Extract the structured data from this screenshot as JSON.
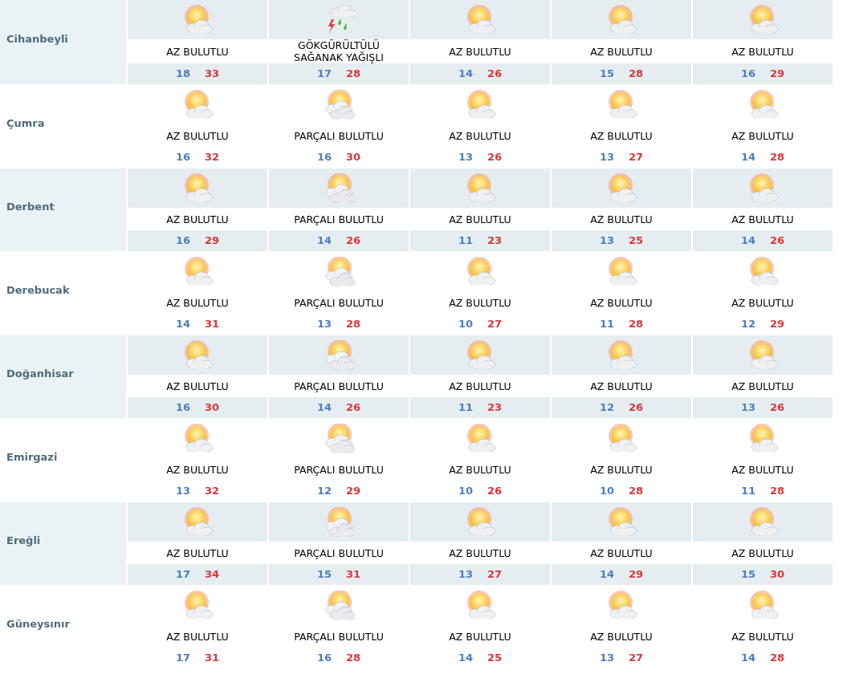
{
  "cities": [
    {
      "name": "Cihanbeyli",
      "days": [
        {
          "kind": "few_clouds",
          "condition": "AZ BULUTLU",
          "low": "18",
          "high": "33"
        },
        {
          "kind": "thunderstorm",
          "condition": "GÖKGÜRÜLTÜLÜ SAĞANAK YAĞIŞLI",
          "low": "17",
          "high": "28"
        },
        {
          "kind": "few_clouds",
          "condition": "AZ BULUTLU",
          "low": "14",
          "high": "26"
        },
        {
          "kind": "few_clouds",
          "condition": "AZ BULUTLU",
          "low": "15",
          "high": "28"
        },
        {
          "kind": "few_clouds",
          "condition": "AZ BULUTLU",
          "low": "16",
          "high": "29"
        }
      ]
    },
    {
      "name": "Çumra",
      "days": [
        {
          "kind": "few_clouds",
          "condition": "AZ BULUTLU",
          "low": "16",
          "high": "32"
        },
        {
          "kind": "partly_cloudy",
          "condition": "PARÇALI BULUTLU",
          "low": "16",
          "high": "30"
        },
        {
          "kind": "few_clouds",
          "condition": "AZ BULUTLU",
          "low": "13",
          "high": "26"
        },
        {
          "kind": "few_clouds",
          "condition": "AZ BULUTLU",
          "low": "13",
          "high": "27"
        },
        {
          "kind": "few_clouds",
          "condition": "AZ BULUTLU",
          "low": "14",
          "high": "28"
        }
      ]
    },
    {
      "name": "Derbent",
      "days": [
        {
          "kind": "few_clouds",
          "condition": "AZ BULUTLU",
          "low": "16",
          "high": "29"
        },
        {
          "kind": "partly_cloudy",
          "condition": "PARÇALI BULUTLU",
          "low": "14",
          "high": "26"
        },
        {
          "kind": "few_clouds",
          "condition": "AZ BULUTLU",
          "low": "11",
          "high": "23"
        },
        {
          "kind": "few_clouds",
          "condition": "AZ BULUTLU",
          "low": "13",
          "high": "25"
        },
        {
          "kind": "few_clouds",
          "condition": "AZ BULUTLU",
          "low": "14",
          "high": "26"
        }
      ]
    },
    {
      "name": "Derebucak",
      "days": [
        {
          "kind": "few_clouds",
          "condition": "AZ BULUTLU",
          "low": "14",
          "high": "31"
        },
        {
          "kind": "partly_cloudy",
          "condition": "PARÇALI BULUTLU",
          "low": "13",
          "high": "28"
        },
        {
          "kind": "few_clouds",
          "condition": "AZ BULUTLU",
          "low": "10",
          "high": "27"
        },
        {
          "kind": "few_clouds",
          "condition": "AZ BULUTLU",
          "low": "11",
          "high": "28"
        },
        {
          "kind": "few_clouds",
          "condition": "AZ BULUTLU",
          "low": "12",
          "high": "29"
        }
      ]
    },
    {
      "name": "Doğanhisar",
      "days": [
        {
          "kind": "few_clouds",
          "condition": "AZ BULUTLU",
          "low": "16",
          "high": "30"
        },
        {
          "kind": "partly_cloudy",
          "condition": "PARÇALI BULUTLU",
          "low": "14",
          "high": "26"
        },
        {
          "kind": "few_clouds",
          "condition": "AZ BULUTLU",
          "low": "11",
          "high": "23"
        },
        {
          "kind": "few_clouds",
          "condition": "AZ BULUTLU",
          "low": "12",
          "high": "26"
        },
        {
          "kind": "few_clouds",
          "condition": "AZ BULUTLU",
          "low": "13",
          "high": "26"
        }
      ]
    },
    {
      "name": "Emirgazi",
      "days": [
        {
          "kind": "few_clouds",
          "condition": "AZ BULUTLU",
          "low": "13",
          "high": "32"
        },
        {
          "kind": "partly_cloudy",
          "condition": "PARÇALI BULUTLU",
          "low": "12",
          "high": "29"
        },
        {
          "kind": "few_clouds",
          "condition": "AZ BULUTLU",
          "low": "10",
          "high": "26"
        },
        {
          "kind": "few_clouds",
          "condition": "AZ BULUTLU",
          "low": "10",
          "high": "28"
        },
        {
          "kind": "few_clouds",
          "condition": "AZ BULUTLU",
          "low": "11",
          "high": "28"
        }
      ]
    },
    {
      "name": "Ereğli",
      "days": [
        {
          "kind": "few_clouds",
          "condition": "AZ BULUTLU",
          "low": "17",
          "high": "34"
        },
        {
          "kind": "partly_cloudy",
          "condition": "PARÇALI BULUTLU",
          "low": "15",
          "high": "31"
        },
        {
          "kind": "few_clouds",
          "condition": "AZ BULUTLU",
          "low": "13",
          "high": "27"
        },
        {
          "kind": "few_clouds",
          "condition": "AZ BULUTLU",
          "low": "14",
          "high": "29"
        },
        {
          "kind": "few_clouds",
          "condition": "AZ BULUTLU",
          "low": "15",
          "high": "30"
        }
      ]
    },
    {
      "name": "Güneysınır",
      "days": [
        {
          "kind": "few_clouds",
          "condition": "AZ BULUTLU",
          "low": "17",
          "high": "31"
        },
        {
          "kind": "partly_cloudy",
          "condition": "PARÇALI BULUTLU",
          "low": "16",
          "high": "28"
        },
        {
          "kind": "few_clouds",
          "condition": "AZ BULUTLU",
          "low": "14",
          "high": "25"
        },
        {
          "kind": "few_clouds",
          "condition": "AZ BULUTLU",
          "low": "13",
          "high": "27"
        },
        {
          "kind": "few_clouds",
          "condition": "AZ BULUTLU",
          "low": "14",
          "high": "28"
        }
      ]
    }
  ]
}
